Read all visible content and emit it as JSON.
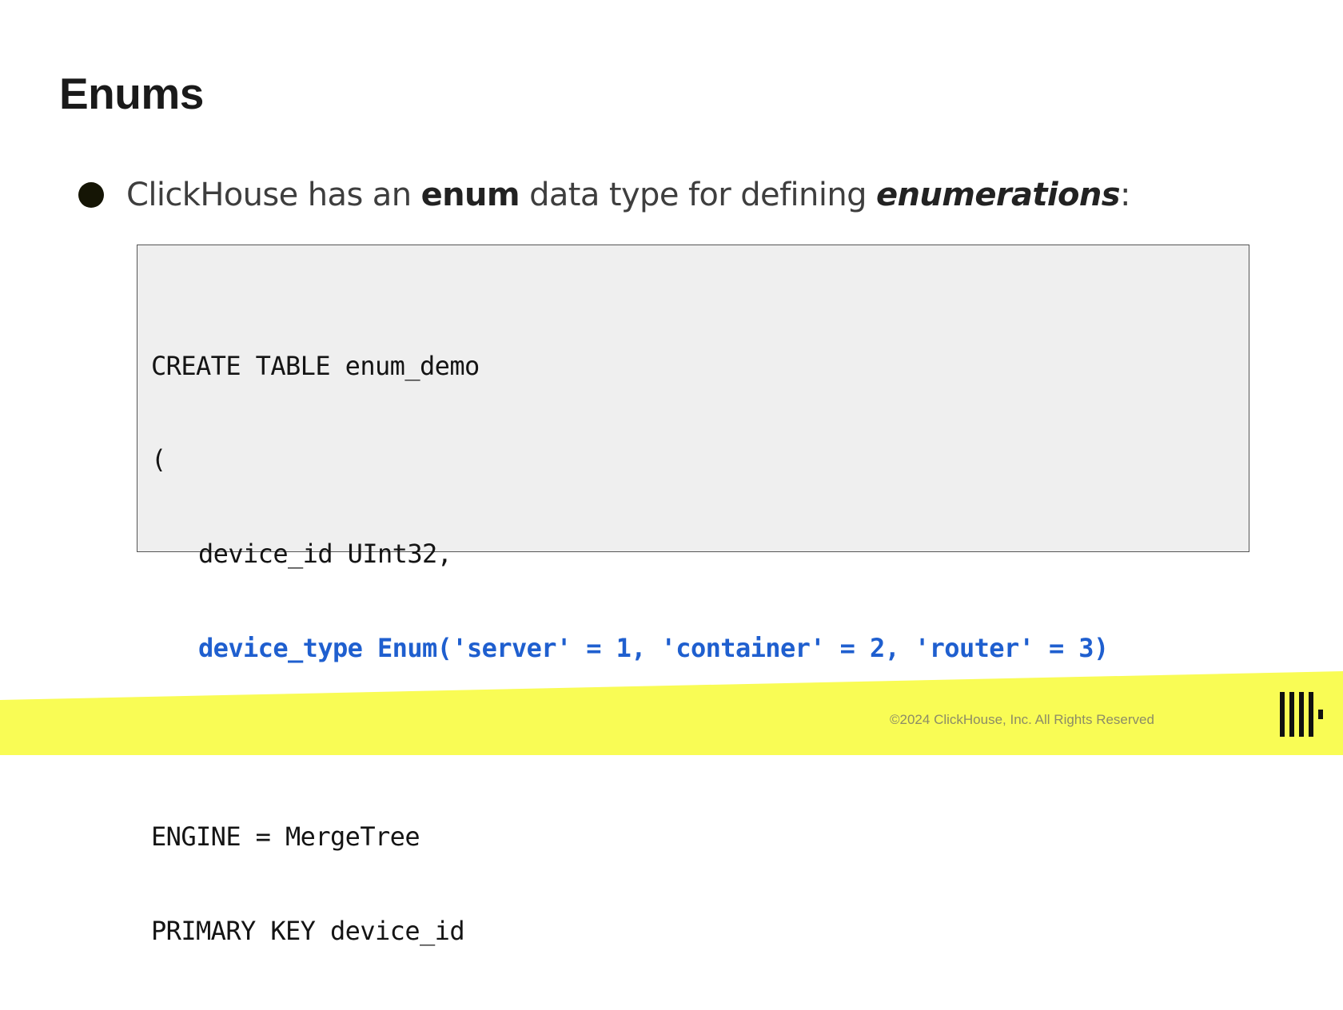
{
  "slide": {
    "title": "Enums"
  },
  "bullet": {
    "part1": "ClickHouse has an ",
    "bold": "enum",
    "part2": " data type for defining ",
    "bold_italic": "enumerations",
    "part3": ":"
  },
  "code": {
    "lines": [
      "CREATE TABLE enum_demo",
      "(",
      "device_id UInt32,",
      "device_type Enum('server' = 1, 'container' = 2, 'router' = 3)",
      ")",
      "ENGINE = MergeTree",
      "PRIMARY KEY device_id"
    ],
    "highlight_color": "#1f5fcf",
    "background_color": "#efefef"
  },
  "footer": {
    "copyright": "©2024 ClickHouse, Inc. All Rights Reserved",
    "band_color": "#f9fc55",
    "logo_icon": "clickhouse-logo-icon"
  }
}
